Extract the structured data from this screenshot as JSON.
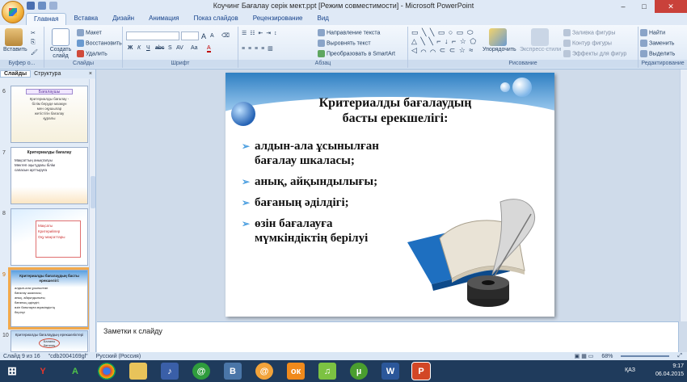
{
  "window": {
    "title": "Коучинг Бағалау серік мект.ppt [Режим совместимости] - Microsoft PowerPoint",
    "minimize": "–",
    "maximize": "□",
    "close": "✕"
  },
  "tabs": [
    "Главная",
    "Вставка",
    "Дизайн",
    "Анимация",
    "Показ слайдов",
    "Рецензирование",
    "Вид"
  ],
  "ribbon": {
    "clipboard": {
      "paste": "Вставить",
      "label": "Буфер о..."
    },
    "slides": {
      "create": "Создать слайд",
      "layout": "Макет",
      "reset": "Восстановить",
      "delete": "Удалить",
      "label": "Слайды"
    },
    "font": {
      "label": "Шрифт",
      "bold": "Ж",
      "italic": "К",
      "underline": "Ч",
      "strike": "abc",
      "shadow": "S",
      "spacing": "AV",
      "case": "Aa",
      "color": "A",
      "grow": "A",
      "shrink": "A"
    },
    "paragraph": {
      "direction": "Направление текста",
      "align": "Выровнять текст",
      "smartart": "Преобразовать в SmartArt",
      "label": "Абзац"
    },
    "drawing": {
      "arrange": "Упорядочить",
      "styles": "Экспресс-стили",
      "fill": "Заливка фигуры",
      "outline": "Контур фигуры",
      "effects": "Эффекты для фигур",
      "label": "Рисование"
    },
    "editing": {
      "find": "Найти",
      "replace": "Заменить",
      "select": "Выделить",
      "label": "Редактирование"
    }
  },
  "panel": {
    "tab_slides": "Слайды",
    "tab_outline": "Структура",
    "close": "×",
    "thumbnails": [
      {
        "num": "6",
        "title": "Бағалаушы",
        "lines": [
          "Критериалды бағалау -",
          "білім беруде мазмұн",
          "мен оқушылар",
          "жетістігін бағалау",
          "құралы"
        ]
      },
      {
        "num": "7",
        "title": "Критериалды бағалау",
        "lines": [
          "Мақсаттың анықталуы",
          "Мектеп оқытудағы білім",
          "сапасын арттыруға"
        ]
      },
      {
        "num": "8",
        "title": "",
        "lines": [
          "Мақсаты",
          "Критерийлер",
          "Оқу мақсаттары"
        ]
      },
      {
        "num": "9",
        "title": "Критериалды бағалаудың басты ерекшелігі:",
        "lines": [
          "алдын-ала ұсынылған бағалау шкаласы;",
          "анық, айқындылығы;",
          "бағаның әділдігі;",
          "өзін бағалауға мүмкіндіктің берілуі"
        ]
      },
      {
        "num": "10",
        "title": "Критериалды бағалаудың ерекшеліктері",
        "lines": [
          "Баланы бағалау"
        ]
      }
    ]
  },
  "slide": {
    "title_line1": "Критериалды бағалаудың",
    "title_line2": "басты ерекшелігі:",
    "bullets": [
      {
        "line1": "алдын-ала ұсынылған",
        "line2": "бағалау шкаласы;"
      },
      {
        "line1": "анық, айқындылығы;",
        "line2": ""
      },
      {
        "line1": "бағаның әділдігі;",
        "line2": ""
      },
      {
        "line1": "өзін бағалауға",
        "line2": "мүмкіндіктің берілуі"
      }
    ]
  },
  "notes": {
    "placeholder": "Заметки к слайду"
  },
  "status": {
    "slide": "Слайд 9 из 16",
    "theme": "\"cdb2004169gl\"",
    "language": "Русский (Россия)",
    "zoom": "68%"
  },
  "taskbar": {
    "apps": [
      "Яндекс",
      "Арма",
      "Chrome",
      "Проводник",
      "Музыка",
      "Rambler",
      "ВКонтакте",
      "Почта",
      "Одноклассники",
      "Угадай",
      "uTorrent",
      "Word",
      "PowerPoint"
    ],
    "lang": "ҚАЗ",
    "time": "9:17",
    "date": "06.04.2015"
  },
  "colors": {
    "accent": "#2f7fc2",
    "selected_thumb": "#f2a94c",
    "taskbar": "#1f3b5c"
  }
}
